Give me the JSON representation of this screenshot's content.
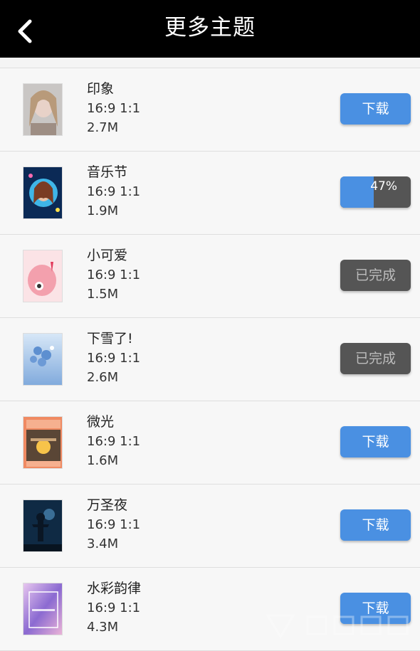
{
  "header": {
    "title": "更多主题"
  },
  "themes": [
    {
      "name": "印象",
      "ratio": "16:9 1:1",
      "size": "2.7M",
      "button": "下载",
      "state": "download"
    },
    {
      "name": "音乐节",
      "ratio": "16:9 1:1",
      "size": "1.9M",
      "button": "47%",
      "state": "progress",
      "progress": 0.47
    },
    {
      "name": "小可爱",
      "ratio": "16:9 1:1",
      "size": "1.5M",
      "button": "已完成",
      "state": "done"
    },
    {
      "name": "下雪了!",
      "ratio": "16:9 1:1",
      "size": "2.6M",
      "button": "已完成",
      "state": "done"
    },
    {
      "name": "微光",
      "ratio": "16:9 1:1",
      "size": "1.6M",
      "button": "下载",
      "state": "download"
    },
    {
      "name": "万圣夜",
      "ratio": "16:9 1:1",
      "size": "3.4M",
      "button": "下载",
      "state": "download"
    },
    {
      "name": "水彩韵律",
      "ratio": "16:9 1:1",
      "size": "4.3M",
      "button": "下载",
      "state": "download"
    }
  ],
  "colors": {
    "accent": "#4a90e2",
    "done": "#555555",
    "header": "#000000"
  }
}
